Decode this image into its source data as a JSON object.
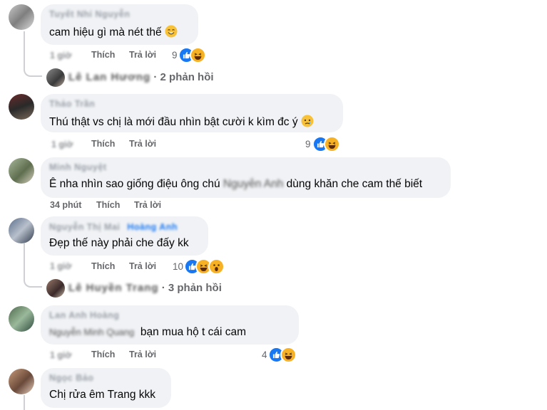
{
  "comments": [
    {
      "author": "Tuyết Nhi Nguyễn",
      "text": "cam hiệu gì mà nét thế",
      "emoji": "smiling-face",
      "time": "1 giờ",
      "like_label": "Thích",
      "reply_label": "Trả lời",
      "reaction_count": "9",
      "reply_summary_name": "Lê Lan Hương",
      "reply_summary_count": " · 2 phản hồi"
    },
    {
      "author": "Thảo Trần",
      "text": "Thú thật vs chị là mới đầu nhìn bật cười k kìm đc ý",
      "emoji": "tear-face",
      "time": "1 giờ",
      "like_label": "Thích",
      "reply_label": "Trả lời",
      "reaction_count": "9"
    },
    {
      "author": "Minh Nguyệt",
      "text_pre": "Ê nha nhìn sao giống điệu ông chú ",
      "text_blur": "Nguyễn Anh",
      "text_post": " dùng khăn che cam thế biết",
      "time": "34 phút",
      "like_label": "Thích",
      "reply_label": "Trả lời"
    },
    {
      "author": "Nguyễn Thị Mai",
      "author_tag": "Hoàng Anh",
      "text": "Đẹp thế này phải che đấy kk",
      "time": "1 giờ",
      "like_label": "Thích",
      "reply_label": "Trả lời",
      "reaction_count": "10",
      "reply_summary_name": "Lê Huyền Trang",
      "reply_summary_count": " · 3 phản hồi"
    },
    {
      "author": "Lan Anh Hoàng",
      "text_blur": "Nguyễn Minh Quang",
      "text_post": "bạn mua hộ t cái cam",
      "time": "1 giờ",
      "like_label": "Thích",
      "reply_label": "Trả lời",
      "reaction_count": "4"
    },
    {
      "author": "Ngọc Bảo",
      "text": "Chị rửa êm Trang kkk"
    }
  ],
  "colors": {
    "like_blue": "#1877f2",
    "reaction_yellow": "#f7b125",
    "bubble": "#f0f2f5",
    "meta_gray": "#65676b"
  }
}
